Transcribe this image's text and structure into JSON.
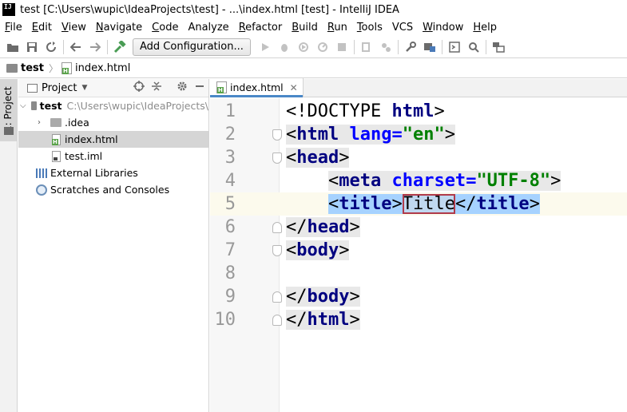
{
  "titlebar": {
    "logo_text": "IJ",
    "title": "test [C:\\Users\\wupic\\IdeaProjects\\test] - ...\\index.html [test] - IntelliJ IDEA"
  },
  "menu": {
    "items": [
      {
        "first": "F",
        "rest": "ile"
      },
      {
        "first": "E",
        "rest": "dit"
      },
      {
        "first": "V",
        "rest": "iew"
      },
      {
        "first": "N",
        "rest": "avigate"
      },
      {
        "first": "C",
        "rest": "ode"
      },
      {
        "first": "",
        "rest": "Analyze"
      },
      {
        "first": "R",
        "rest": "efactor"
      },
      {
        "first": "B",
        "rest": "uild"
      },
      {
        "first": "R",
        "rest": "un"
      },
      {
        "first": "T",
        "rest": "ools"
      },
      {
        "first": "",
        "rest": "VCS"
      },
      {
        "first": "W",
        "rest": "indow"
      },
      {
        "first": "H",
        "rest": "elp"
      }
    ]
  },
  "toolbar": {
    "config_label": "Add Configuration..."
  },
  "breadcrumb": {
    "project": "test",
    "file": "index.html"
  },
  "left_strip": {
    "label": "1: Project"
  },
  "project_panel": {
    "title": "Project",
    "tree": {
      "root_name": "test",
      "root_path": "C:\\Users\\wupic\\IdeaProjects\\",
      "idea_folder": ".idea",
      "index_file": "index.html",
      "iml_file": "test.iml",
      "external_libraries": "External Libraries",
      "scratches": "Scratches and Consoles"
    }
  },
  "editor": {
    "tab_label": "index.html",
    "line_numbers": [
      "1",
      "2",
      "3",
      "4",
      "5",
      "6",
      "7",
      "8",
      "9",
      "10"
    ],
    "current_line": 5,
    "code": {
      "l1_a": "<!DOCTYPE ",
      "l1_b": "html",
      "l1_c": ">",
      "l2_open": "<",
      "l2_tag": "html",
      "l2_attr": " lang",
      "l2_eq": "=",
      "l2_val": "\"en\"",
      "l2_close": ">",
      "l3_open": "<",
      "l3_tag": "head",
      "l3_close": ">",
      "l4_indent": "    ",
      "l4_open": "<",
      "l4_tag": "meta",
      "l4_attr": " charset",
      "l4_eq": "=",
      "l4_val": "\"UTF-8\"",
      "l4_close": ">",
      "l5_indent": "    ",
      "l5_open": "<",
      "l5_tag": "title",
      "l5_close": ">",
      "l5_text": "Title",
      "l5_end_open": "</",
      "l5_end_tag": "title",
      "l5_end_close": ">",
      "l6_open": "</",
      "l6_tag": "head",
      "l6_close": ">",
      "l7_open": "<",
      "l7_tag": "body",
      "l7_close": ">",
      "l9_open": "</",
      "l9_tag": "body",
      "l9_close": ">",
      "l10_open": "</",
      "l10_tag": "html",
      "l10_close": ">"
    }
  },
  "colors": {
    "tag": "#000080",
    "attribute": "#0000ff",
    "value": "#008000",
    "selection": "#a6d2ff",
    "current_line": "#fcfaed"
  }
}
